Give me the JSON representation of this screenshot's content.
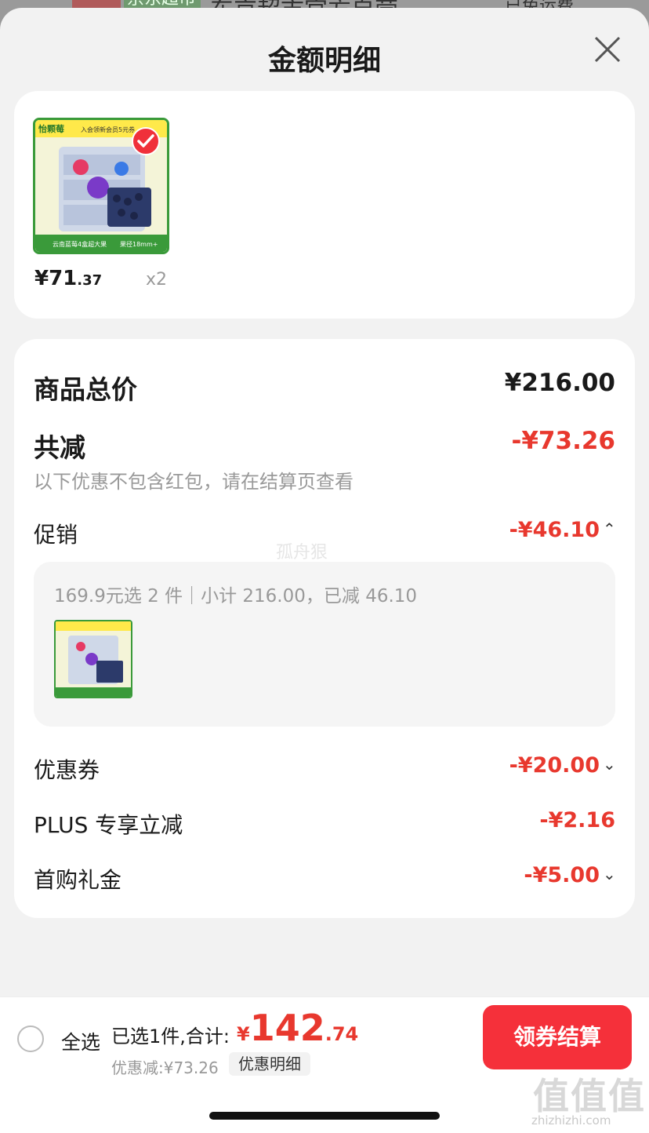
{
  "backdrop": {
    "tag_green": "京东超市",
    "title": "东京超市官方自营",
    "right_text": "已免运费"
  },
  "sheet": {
    "title": "金额明细"
  },
  "product": {
    "price_int": "¥71",
    "price_dec": ".37",
    "quantity": "x2",
    "image_texts": {
      "brand": "怡颗莓",
      "banner": "入会领新会员5元券",
      "footer_left": "云南蓝莓4盒超大果",
      "footer_right": "果径18mm+"
    }
  },
  "summary": {
    "total_label": "商品总价",
    "total_value": "¥216.00",
    "reduced_label": "共减",
    "reduced_value": "-¥73.26",
    "note": "以下优惠不包含红包，请在结算页查看",
    "promo_label": "促销",
    "promo_value": "-¥46.10",
    "promo_detail": "169.9元选 2 件｜小计 216.00，已减 46.10",
    "coupon_label": "优惠券",
    "coupon_value": "-¥20.00",
    "plus_label": "PLUS 专享立减",
    "plus_value": "-¥2.16",
    "first_label": "首购礼金",
    "first_value": "-¥5.00"
  },
  "watermark": "孤舟狠",
  "bottom": {
    "select_all": "全选",
    "selected_text": "已选1件,合计:",
    "total_cur": "¥",
    "total_int": "142",
    "total_dec": ".74",
    "discount_text": "优惠减:¥73.26",
    "detail_link": "优惠明细",
    "checkout": "领券结算"
  },
  "site_watermark": {
    "logo": "值值值",
    "url": "zhizhizhi.com"
  },
  "colors": {
    "accent_red": "#e8382e",
    "button_red": "#f5303a",
    "background": "#f2f2f2"
  }
}
